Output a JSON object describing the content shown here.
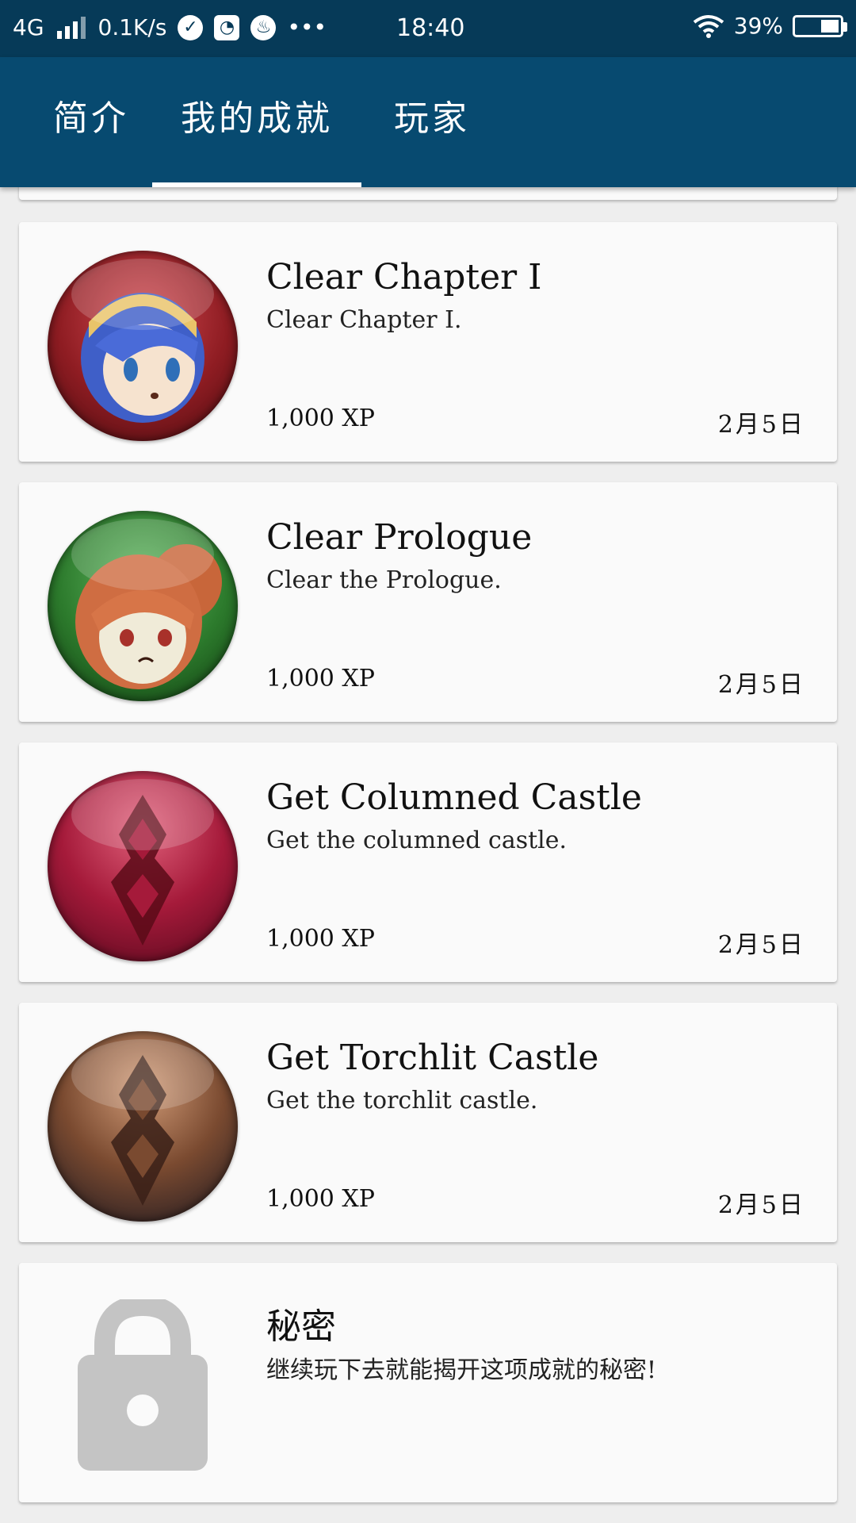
{
  "status_bar": {
    "network": "4G",
    "speed": "0.1K/s",
    "time": "18:40",
    "battery": "39%",
    "more": "•••",
    "icons": [
      "signal-icon",
      "check-circle-icon",
      "compass-icon",
      "flame-icon",
      "wifi-icon",
      "battery-icon"
    ]
  },
  "tabs": [
    {
      "label": "简介"
    },
    {
      "label": "我的成就",
      "selected": true
    },
    {
      "label": "玩家"
    }
  ],
  "colors": {
    "status_bar": "#063a58",
    "app_bar": "#074a70",
    "card": "#fafafa",
    "background": "#eeeeee",
    "lock": "#c4c4c4"
  },
  "achievements": [
    {
      "title": "Clear Chapter I",
      "description": "Clear Chapter I.",
      "xp": "1,000 XP",
      "date": "2月5日",
      "badge": "blue-haired-hero-portrait"
    },
    {
      "title": "Clear Prologue",
      "description": "Clear the Prologue.",
      "xp": "1,000 XP",
      "date": "2月5日",
      "badge": "red-haired-hero-portrait"
    },
    {
      "title": "Get Columned Castle",
      "description": "Get the columned castle.",
      "xp": "1,000 XP",
      "date": "2月5日",
      "badge": "crimson-emblem"
    },
    {
      "title": "Get Torchlit Castle",
      "description": "Get the torchlit castle.",
      "xp": "1,000 XP",
      "date": "2月5日",
      "badge": "bronze-emblem"
    }
  ],
  "secret": {
    "title": "秘密",
    "description": "继续玩下去就能揭开这项成就的秘密!",
    "icon": "lock-icon"
  }
}
